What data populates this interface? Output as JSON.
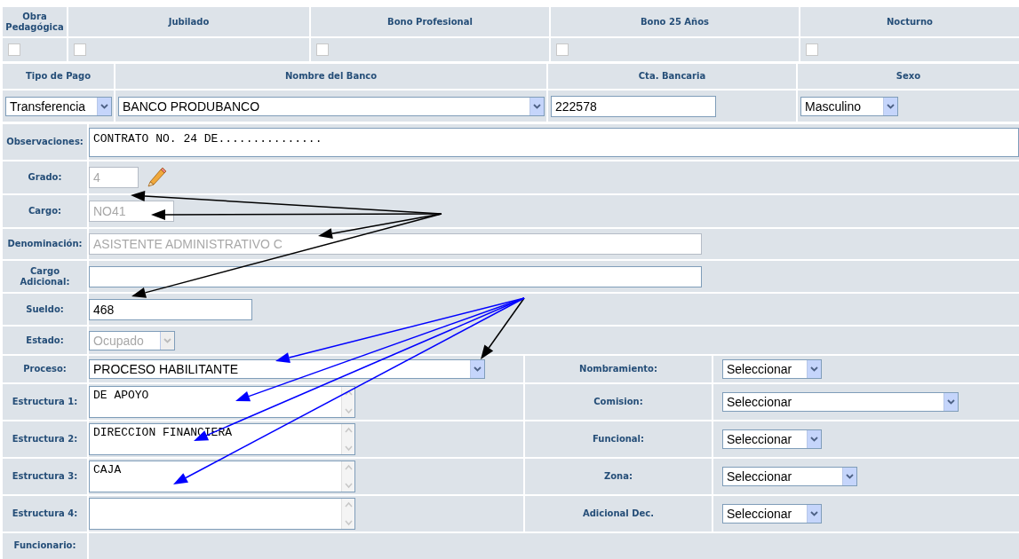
{
  "flags": [
    {
      "label": "Obra Pedagógica",
      "checked": false
    },
    {
      "label": "Jubilado",
      "checked": false
    },
    {
      "label": "Bono Profesional",
      "checked": false
    },
    {
      "label": "Bono 25 Años",
      "checked": false
    },
    {
      "label": "Nocturno",
      "checked": false
    }
  ],
  "payment": [
    {
      "label": "Tipo de Pago",
      "kind": "select",
      "value": "Transferencia"
    },
    {
      "label": "Nombre del Banco",
      "kind": "select",
      "value": "BANCO PRODUBANCO"
    },
    {
      "label": "Cta. Bancaria",
      "kind": "text",
      "value": "222578"
    },
    {
      "label": "Sexo",
      "kind": "select",
      "value": "Masculino"
    }
  ],
  "observaciones": {
    "label": "Observaciones:",
    "value": "CONTRATO NO. 24 DE..............."
  },
  "fields": [
    {
      "label": "Grado:",
      "kind": "text",
      "value": "4",
      "disabled": true,
      "editable": true
    },
    {
      "label": "Cargo:",
      "kind": "text",
      "value": "NO41",
      "disabled": true
    },
    {
      "label": "Denominación:",
      "kind": "text",
      "value": "ASISTENTE ADMINISTRATIVO C",
      "disabled": true
    },
    {
      "label": "Cargo Adicional:",
      "kind": "text",
      "disabled": false
    },
    {
      "label": "Sueldo:",
      "kind": "text",
      "value": "468",
      "disabled": false
    },
    {
      "label": "Estado:",
      "kind": "select",
      "value": "Ocupado",
      "disabled": true
    }
  ],
  "split_rows": [
    {
      "left": {
        "label": "Proceso:",
        "kind": "select",
        "value": "PROCESO HABILITANTE"
      },
      "right": {
        "label": "Nombramiento:",
        "kind": "select",
        "value": "Seleccionar"
      }
    },
    {
      "left": {
        "label": "Estructura 1:",
        "kind": "textarea",
        "value": "DE APOYO"
      },
      "right": {
        "label": "Comision:",
        "kind": "select",
        "value": "Seleccionar"
      }
    },
    {
      "left": {
        "label": "Estructura 2:",
        "kind": "textarea",
        "value": "DIRECCION FINANCIERA"
      },
      "right": {
        "label": "Funcional:",
        "kind": "select",
        "value": "Seleccionar"
      }
    },
    {
      "left": {
        "label": "Estructura 3:",
        "kind": "textarea",
        "value": "CAJA"
      },
      "right": {
        "label": "Zona:",
        "kind": "select",
        "value": "Seleccionar"
      }
    },
    {
      "left": {
        "label": "Estructura 4:",
        "kind": "textarea"
      },
      "right": {
        "label": "Adicional Dec.",
        "kind": "select",
        "value": "Seleccionar"
      }
    }
  ],
  "footer": {
    "label": "Funcionario:"
  }
}
